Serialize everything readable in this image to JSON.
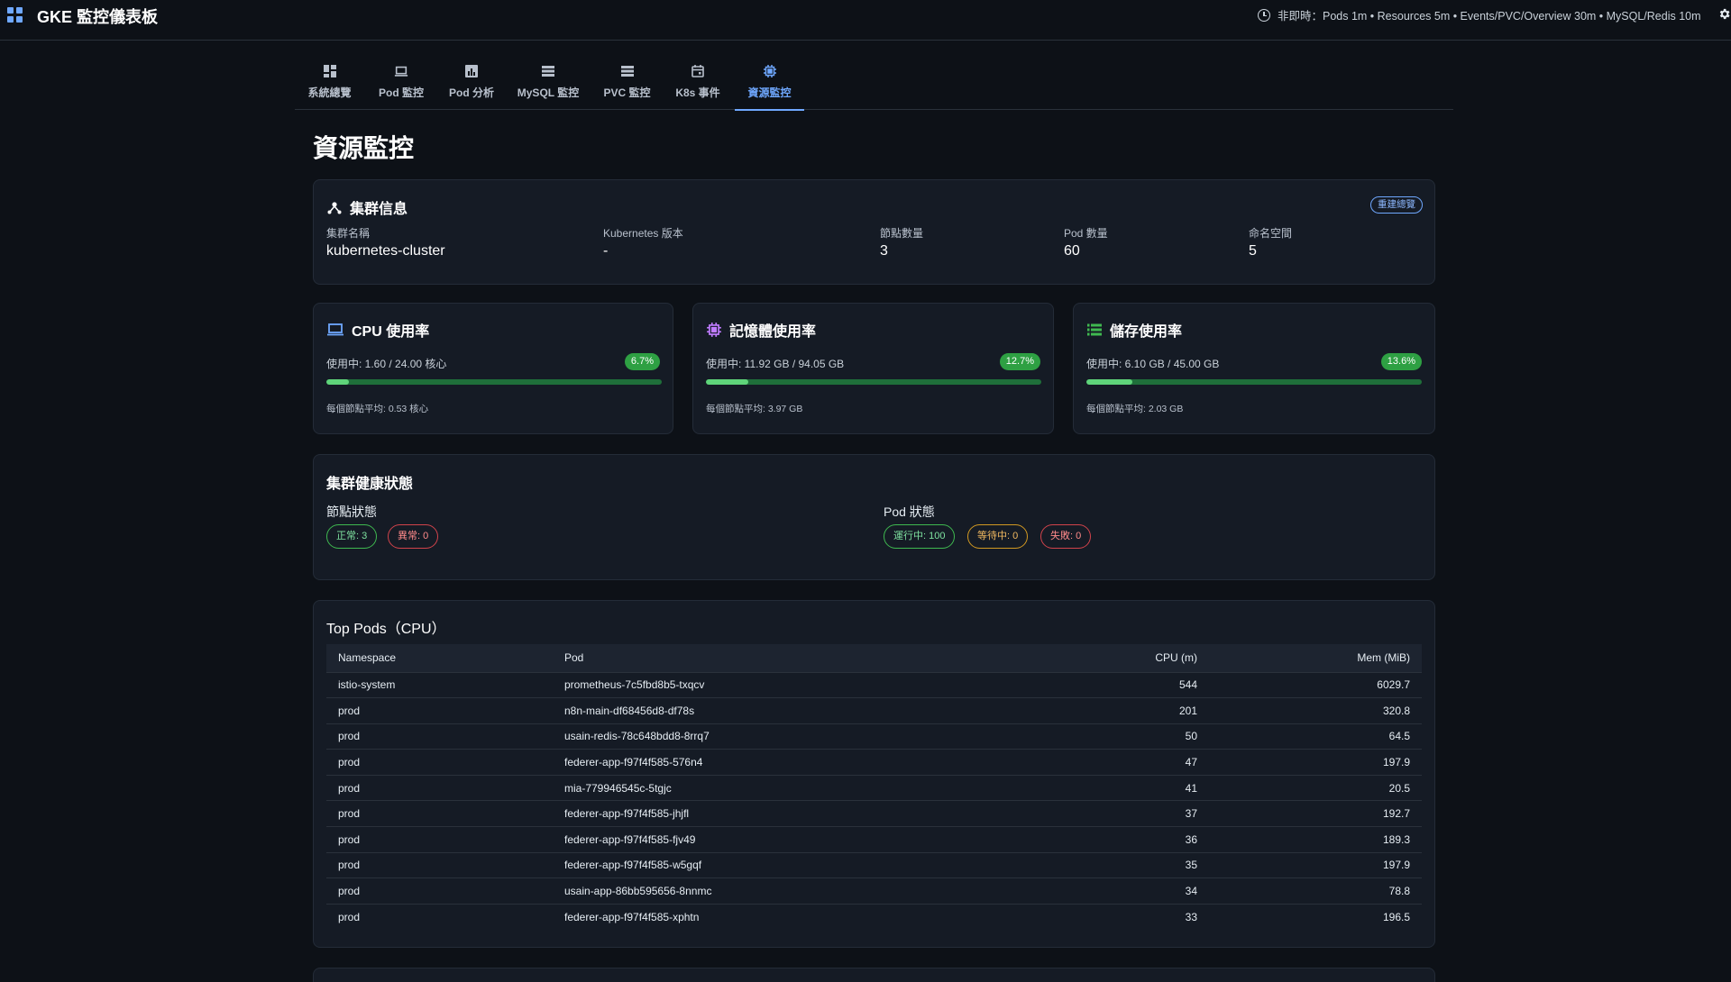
{
  "header": {
    "title": "GKE 監控儀表板",
    "refresh_text": "非即時：Pods 1m • Resources 5m • Events/PVC/Overview 30m • MySQL/Redis 10m"
  },
  "tabs": [
    {
      "label": "系統總覽",
      "icon": "dashboard-icon"
    },
    {
      "label": "Pod 監控",
      "icon": "laptop-icon"
    },
    {
      "label": "Pod 分析",
      "icon": "analytics-icon"
    },
    {
      "label": "MySQL 監控",
      "icon": "storage-icon"
    },
    {
      "label": "PVC 監控",
      "icon": "storage-icon"
    },
    {
      "label": "K8s 事件",
      "icon": "calendar-icon"
    },
    {
      "label": "資源監控",
      "icon": "chip-icon",
      "active": true
    }
  ],
  "page_title": "資源監控",
  "cluster_info": {
    "title": "集群信息",
    "rebuild_label": "重建總覽",
    "fields": [
      {
        "label": "集群名稱",
        "value": "kubernetes-cluster"
      },
      {
        "label": "Kubernetes 版本",
        "value": "-"
      },
      {
        "label": "節點數量",
        "value": "3"
      },
      {
        "label": "Pod 數量",
        "value": "60"
      },
      {
        "label": "命名空間",
        "value": "5"
      }
    ]
  },
  "usage_cards": [
    {
      "title": "CPU 使用率",
      "icon": "laptop-icon",
      "icon_color": "#6fa8ff",
      "usage": "使用中: 1.60 / 24.00 核心",
      "percent_label": "6.7%",
      "percent": 6.7,
      "avg": "每個節點平均: 0.53 核心"
    },
    {
      "title": "記憶體使用率",
      "icon": "chip-icon",
      "icon_color": "#c07cff",
      "usage": "使用中: 11.92 GB / 94.05 GB",
      "percent_label": "12.7%",
      "percent": 12.7,
      "avg": "每個節點平均: 3.97 GB"
    },
    {
      "title": "儲存使用率",
      "icon": "storage-icon",
      "icon_color": "#3fb950",
      "usage": "使用中: 6.10 GB / 45.00 GB",
      "percent_label": "13.6%",
      "percent": 13.6,
      "avg": "每個節點平均: 2.03 GB"
    }
  ],
  "health": {
    "title": "集群健康狀態",
    "node_label": "節點狀態",
    "node_chips": [
      {
        "text": "正常: 3",
        "color": "green"
      },
      {
        "text": "異常: 0",
        "color": "red"
      }
    ],
    "pod_label": "Pod 狀態",
    "pod_chips": [
      {
        "text": "運行中: 100",
        "color": "green"
      },
      {
        "text": "等待中: 0",
        "color": "orange"
      },
      {
        "text": "失敗: 0",
        "color": "red"
      }
    ]
  },
  "top_pods": {
    "title": "Top Pods（CPU）",
    "columns": [
      "Namespace",
      "Pod",
      "CPU (m)",
      "Mem (MiB)"
    ],
    "rows": [
      [
        "istio-system",
        "prometheus-7c5fbd8b5-txqcv",
        "544",
        "6029.7"
      ],
      [
        "prod",
        "n8n-main-df68456d8-df78s",
        "201",
        "320.8"
      ],
      [
        "prod",
        "usain-redis-78c648bdd8-8rrq7",
        "50",
        "64.5"
      ],
      [
        "prod",
        "federer-app-f97f4f585-576n4",
        "47",
        "197.9"
      ],
      [
        "prod",
        "mia-779946545c-5tgjc",
        "41",
        "20.5"
      ],
      [
        "prod",
        "federer-app-f97f4f585-jhjfl",
        "37",
        "192.7"
      ],
      [
        "prod",
        "federer-app-f97f4f585-fjv49",
        "36",
        "189.3"
      ],
      [
        "prod",
        "federer-app-f97f4f585-w5gqf",
        "35",
        "197.9"
      ],
      [
        "prod",
        "usain-app-86bb595656-8nnmc",
        "34",
        "78.8"
      ],
      [
        "prod",
        "federer-app-f97f4f585-xphtn",
        "33",
        "196.5"
      ]
    ]
  }
}
